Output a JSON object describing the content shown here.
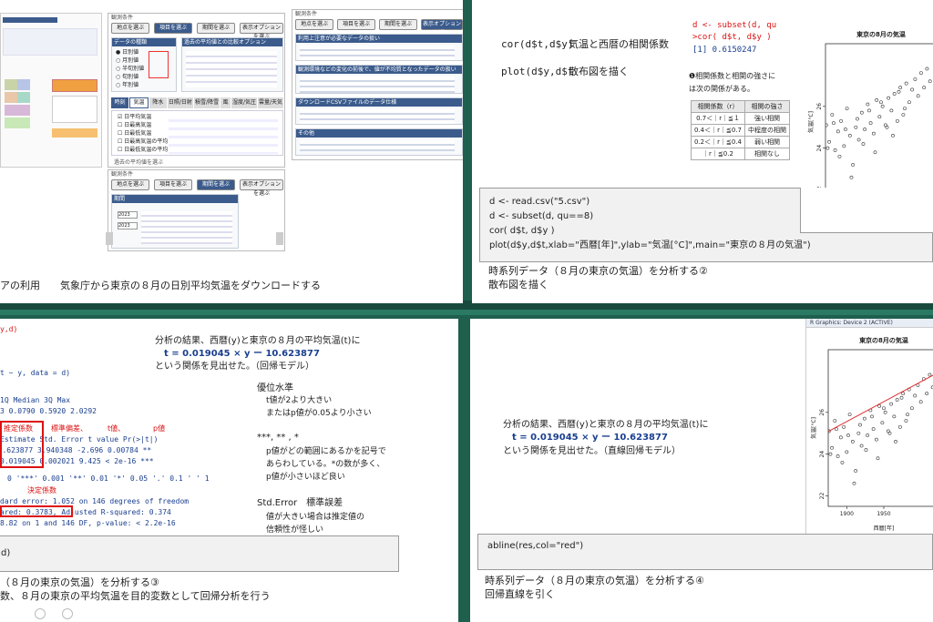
{
  "slides": {
    "s1": {
      "caption": "アの利用　　気象庁から東京の８月の日別平均気温をダウンロードする",
      "win1": {
        "title": "観測条件",
        "buttons": [
          "地点を選ぶ",
          "項目を選ぶ",
          "期間を選ぶ",
          "表示オプションを選ぶ"
        ],
        "heading1": "データの種類",
        "heading2": "過去の平均値との比較オプション",
        "opt1": "日別値",
        "opt2": "月別値",
        "opt3": "半旬別値",
        "opt4": "旬別値",
        "opt5": "年別値",
        "tabs": [
          "時刻",
          "気温",
          "降水",
          "日照/日射",
          "積雪/降雪",
          "風",
          "湿度/気圧",
          "雲量/天気"
        ],
        "items": [
          "日平均気温",
          "日最高気温",
          "日最低気温",
          "日最高気温の平均",
          "日最低気温の平均"
        ],
        "note": "過去の平均値を選ぶ"
      },
      "win2": {
        "title": "観測条件",
        "buttons": [
          "地点を選ぶ",
          "項目を選ぶ",
          "期間を選ぶ",
          "表示オプションを選ぶ"
        ],
        "h1": "利用上注意が必要なデータの扱い",
        "h2": "観測環境などの変化の前後で、値が不均質となったデータの扱い",
        "h3": "ダウンロードCSVファイルのデータ仕様",
        "h4": "その他"
      },
      "win3": {
        "title": "観測条件",
        "buttons": [
          "地点を選ぶ",
          "項目を選ぶ",
          "期間を選ぶ",
          "表示オプションを選ぶ"
        ],
        "h1": "期間",
        "f1": "2023",
        "f2": "2023"
      }
    },
    "s2": {
      "cmd1": "cor(d$t,d$y)",
      "desc1": "気温と西暦の相関係数",
      "cmd2": "plot(d$y,d$t",
      "desc2": "散布図を描く",
      "console": [
        "d <- subset(d, qu",
        ">cor( d$t, d$y )",
        "[1] 0.6150247"
      ],
      "note": "❶相関係数と相関の強さに\nは次の関係がある。",
      "table_head": [
        "相関係数（r）",
        "相関の強さ"
      ],
      "table_rows": [
        [
          "0.7＜｜r｜≦１",
          "強い相関"
        ],
        [
          "0.4＜｜r｜≦0.7",
          "中程度の相関"
        ],
        [
          "0.2＜｜r｜≦0.4",
          "弱い相関"
        ],
        [
          "｜r｜≦0.2",
          "相関なし"
        ]
      ],
      "code": [
        "d <- read.csv(\"5.csv\")",
        "d <- subset(d, qu==8)",
        "cor( d$t, d$y )",
        "plot(d$y,d$t,xlab=\"西暦[年]\",ylab=\"気温[°C]\",main=\"東京の８月の気温\")"
      ],
      "caption1": "時系列データ（８月の東京の気温）を分析する②",
      "caption2": "散布図を描く",
      "plot_title": "東京の8月の気温",
      "plot_xlabel": "西暦[年]",
      "plot_ylabel": "気温[°C]"
    },
    "s3": {
      "console_lines": [
        "y,d)",
        "t ~ y, data = d)",
        "1Q   Median      3Q     Max",
        "3  0.0790  0.5920  2.0292",
        "Estimate Std. Error t value Pr(>|t|)",
        "-10.623877   3.940348  -2.696  0.00784 **",
        "0.019045   0.002021   9.425  < 2e-16 ***",
        "0 '***' 0.001 '**' 0.01 '*' 0.05 '.' 0.1 ' ' 1",
        "dard error: 1.052 on 146 degrees of freedom",
        "ared:  0.3783,    Adjusted R-squared:  0.374",
        "8.82 on 1 and 146 DF,  p-value: < 2.2e-16"
      ],
      "lbl_est": "推定係数",
      "lbl_se": "標準偏差、",
      "lbl_t": "t値、",
      "lbl_p": "p値",
      "lbl_r2": "決定係数",
      "result1": "分析の結果、西暦(y)と東京の８月の平均気温(t)に",
      "formula": "t = 0.019045 × y ー 10.623877",
      "result2": "という関係を見出せた。（回帰モデル）",
      "sig_title": "優位水準",
      "sig1": "t値が2より大きい",
      "sig2": "またはp値が0.05より小さい",
      "star_title": "***, ** , *",
      "star1": "p値がどの範囲にあるかを記号で",
      "star2": "あらわしている。*の数が多く、",
      "star3": "p値が小さいほど良い",
      "se_title": "Std.Error　標準誤差",
      "se1": "値が大きい場合は推定値の",
      "se2": "信頼性が怪しい",
      "code": "d)",
      "caption1": "（８月の東京の気温）を分析する③",
      "caption2": "数、８月の東京の平均気温を目的変数として回帰分析を行う"
    },
    "s4": {
      "result1": "分析の結果、西暦(y)と東京の８月の平均気温(t)に",
      "formula": "t = 0.019045 × y ー 10.623877",
      "result2": "という関係を見出せた。（直線回帰モデル）",
      "code": "abline(res,col=\"red\")",
      "caption1": "時系列データ（８月の東京の気温）を分析する④",
      "caption2": "回帰直線を引く",
      "window_title": "R Graphics: Device 2 (ACTIVE)",
      "plot_title": "東京の8月の気温",
      "plot_xlabel": "西暦[年]",
      "plot_ylabel": "気温[°C]"
    }
  },
  "chart_data": [
    {
      "type": "scatter",
      "title": "東京の8月の気温",
      "xlabel": "西暦[年]",
      "ylabel": "気温[°C]",
      "xlim": [
        1875,
        2025
      ],
      "ylim": [
        21.5,
        29
      ],
      "xticks": [
        1900,
        1950
      ],
      "yticks": [
        22,
        24,
        26
      ],
      "x": [
        1876,
        1880,
        1884,
        1888,
        1892,
        1896,
        1900,
        1904,
        1908,
        1912,
        1916,
        1920,
        1924,
        1928,
        1932,
        1936,
        1940,
        1944,
        1948,
        1952,
        1956,
        1960,
        1964,
        1968,
        1972,
        1976,
        1980,
        1984,
        1988,
        1992,
        1996,
        2000,
        2004,
        2008,
        2012,
        2016,
        1878,
        1886,
        1894,
        1902,
        1910,
        1918,
        1926,
        1934,
        1942,
        1950,
        1958,
        1966,
        1974,
        1982
      ],
      "y": [
        25.1,
        24.3,
        25.6,
        23.9,
        24.8,
        25.3,
        24.1,
        25.9,
        24.6,
        23.2,
        25.0,
        24.4,
        25.7,
        24.9,
        26.1,
        25.2,
        24.7,
        26.3,
        25.5,
        26.0,
        25.1,
        26.4,
        25.8,
        26.6,
        25.3,
        26.9,
        25.6,
        27.1,
        26.2,
        26.8,
        27.3,
        26.5,
        27.6,
        26.9,
        27.8,
        27.2,
        24.0,
        25.2,
        23.6,
        24.9,
        22.6,
        25.4,
        24.2,
        25.8,
        23.8,
        26.2,
        25.0,
        24.6,
        26.7,
        25.9
      ]
    },
    {
      "type": "scatter",
      "title": "東京の8月の気温",
      "xlabel": "西暦[年]",
      "ylabel": "気温[°C]",
      "xlim": [
        1875,
        2025
      ],
      "ylim": [
        21.5,
        29
      ],
      "xticks": [
        1900,
        1950
      ],
      "yticks": [
        22,
        24,
        26
      ],
      "regression": {
        "slope": 0.019045,
        "intercept": -10.623877,
        "color": "#e03030"
      }
    }
  ]
}
